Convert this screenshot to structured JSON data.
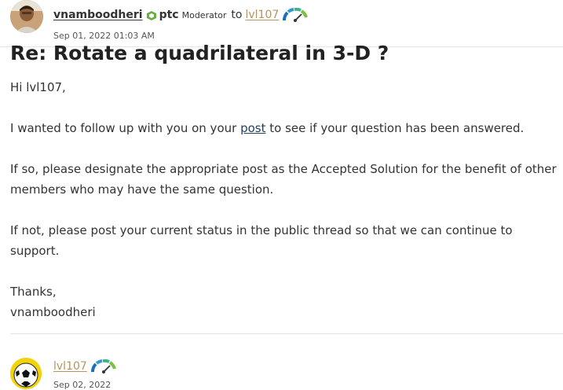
{
  "post": {
    "author": "vnamboodheri",
    "company_label": "ptc",
    "role": "Moderator",
    "to_text": "to",
    "recipient": "lvl107",
    "date": "Sep 01, 2022 01:03 AM",
    "title": "Re: Rotate a quadrilateral in 3-D ?",
    "greeting": "Hi lvl107,",
    "para1_before": "I wanted to follow up with you on your ",
    "para1_link": "post",
    "para1_after": " to see if your question has been answered.",
    "para2": "If so, please designate the appropriate post as the Accepted Solution for the benefit of other members who may have the same question.",
    "para3": "If not, please post your current status in the public thread so that we can continue to support.",
    "closing": "Thanks,",
    "signature": "vnamboodheri"
  },
  "reply": {
    "author": "lvl107",
    "date": "Sep 02, 2022"
  },
  "colors": {
    "recipient_link": "#b39560",
    "post_link": "#23405f",
    "ptc_green": "#6cae3e"
  }
}
